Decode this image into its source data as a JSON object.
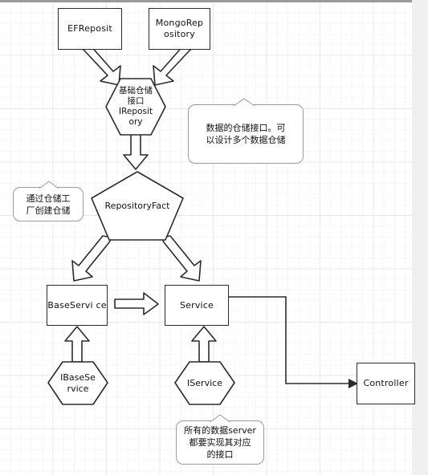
{
  "canvas": {
    "background": "#ffffff",
    "grid_minor_color": "#f6f6f6",
    "grid_major_color": "#e9e9e9",
    "shape_stroke": "#2b2b2b",
    "note_stroke": "#9a9a9a",
    "text_color": "#111111"
  },
  "nodes": {
    "ef_repository": {
      "label": "EFReposit",
      "type": "rectangle"
    },
    "mongo_repository": {
      "label": "MongoRep\nository",
      "type": "rectangle"
    },
    "irepository": {
      "label": "基础仓储\n接口\nIReposit\nory",
      "type": "hexagon"
    },
    "repository_factory": {
      "label": "RepositoryFact",
      "type": "pentagon"
    },
    "base_service": {
      "label": "BaseServi\nce",
      "type": "rectangle"
    },
    "service": {
      "label": "Service",
      "type": "rectangle"
    },
    "ibase_service": {
      "label": "IBaseSe\nrvice",
      "type": "hexagon"
    },
    "iservice": {
      "label": "IService",
      "type": "hexagon"
    },
    "controller": {
      "label": "Controller",
      "type": "rectangle"
    }
  },
  "notes": {
    "repository_note": {
      "text": "数据的仓储接口。可\n以设计多个数据仓储"
    },
    "factory_note": {
      "text": "通过仓储工\n厂创建仓储"
    },
    "service_note": {
      "text": "所有的数据server\n都要实现其对应\n的接口"
    }
  },
  "connections": [
    {
      "name": "ef-to-irepository",
      "style": "block-arrow",
      "from": "ef_repository",
      "to": "irepository"
    },
    {
      "name": "mongo-to-irepository",
      "style": "block-arrow",
      "from": "mongo_repository",
      "to": "irepository"
    },
    {
      "name": "irepository-to-factory",
      "style": "block-arrow",
      "from": "irepository",
      "to": "repository_factory"
    },
    {
      "name": "factory-to-baseservice",
      "style": "block-arrow",
      "from": "repository_factory",
      "to": "base_service"
    },
    {
      "name": "factory-to-service",
      "style": "block-arrow",
      "from": "repository_factory",
      "to": "service"
    },
    {
      "name": "baseservice-to-service",
      "style": "block-arrow",
      "from": "base_service",
      "to": "service"
    },
    {
      "name": "ibaseservice-to-baseservice",
      "style": "block-arrow",
      "from": "ibase_service",
      "to": "base_service"
    },
    {
      "name": "iservice-to-service",
      "style": "block-arrow",
      "from": "iservice",
      "to": "service"
    },
    {
      "name": "service-to-controller",
      "style": "line-arrow",
      "from": "service",
      "to": "controller"
    }
  ]
}
